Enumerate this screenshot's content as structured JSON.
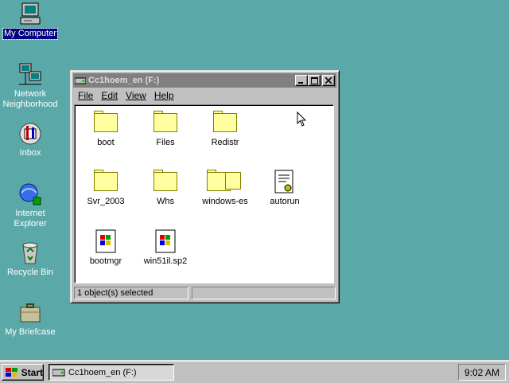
{
  "desktop": {
    "icons": [
      {
        "label": "My Computer",
        "icon": "computer-icon"
      },
      {
        "label": "Network\nNeighborhood",
        "icon": "network-icon"
      },
      {
        "label": "Inbox",
        "icon": "inbox-icon"
      },
      {
        "label": "Internet\nExplorer",
        "icon": "internet-explorer-icon"
      },
      {
        "label": "Recycle Bin",
        "icon": "recycle-bin-icon"
      },
      {
        "label": "My Briefcase",
        "icon": "briefcase-icon"
      }
    ]
  },
  "window": {
    "title": "Cc1hoem_en (F:)",
    "menu": {
      "file": "File",
      "edit": "Edit",
      "view": "View",
      "help": "Help"
    },
    "items": [
      {
        "label": "boot",
        "icon": "folder-icon"
      },
      {
        "label": "Files",
        "icon": "folder-icon"
      },
      {
        "label": "Redistr",
        "icon": "folder-icon"
      },
      {
        "label": "Svr_2003",
        "icon": "folder-icon"
      },
      {
        "label": "Whs",
        "icon": "folder-icon"
      },
      {
        "label": "windows-es",
        "icon": "folder-icon"
      },
      {
        "label": "autorun",
        "icon": "setup-file-icon"
      },
      {
        "label": "bootmgr",
        "icon": "windows-file-icon"
      },
      {
        "label": "win51il.sp2",
        "icon": "windows-file-icon"
      }
    ],
    "status": "1 object(s) selected"
  },
  "taskbar": {
    "start_label": "Start",
    "task_label": "Cc1hoem_en (F:)",
    "clock": "9:02 AM"
  },
  "colors": {
    "desktop": "#5aa8a8",
    "selection": "#000080",
    "folder": "#ffffa0"
  }
}
